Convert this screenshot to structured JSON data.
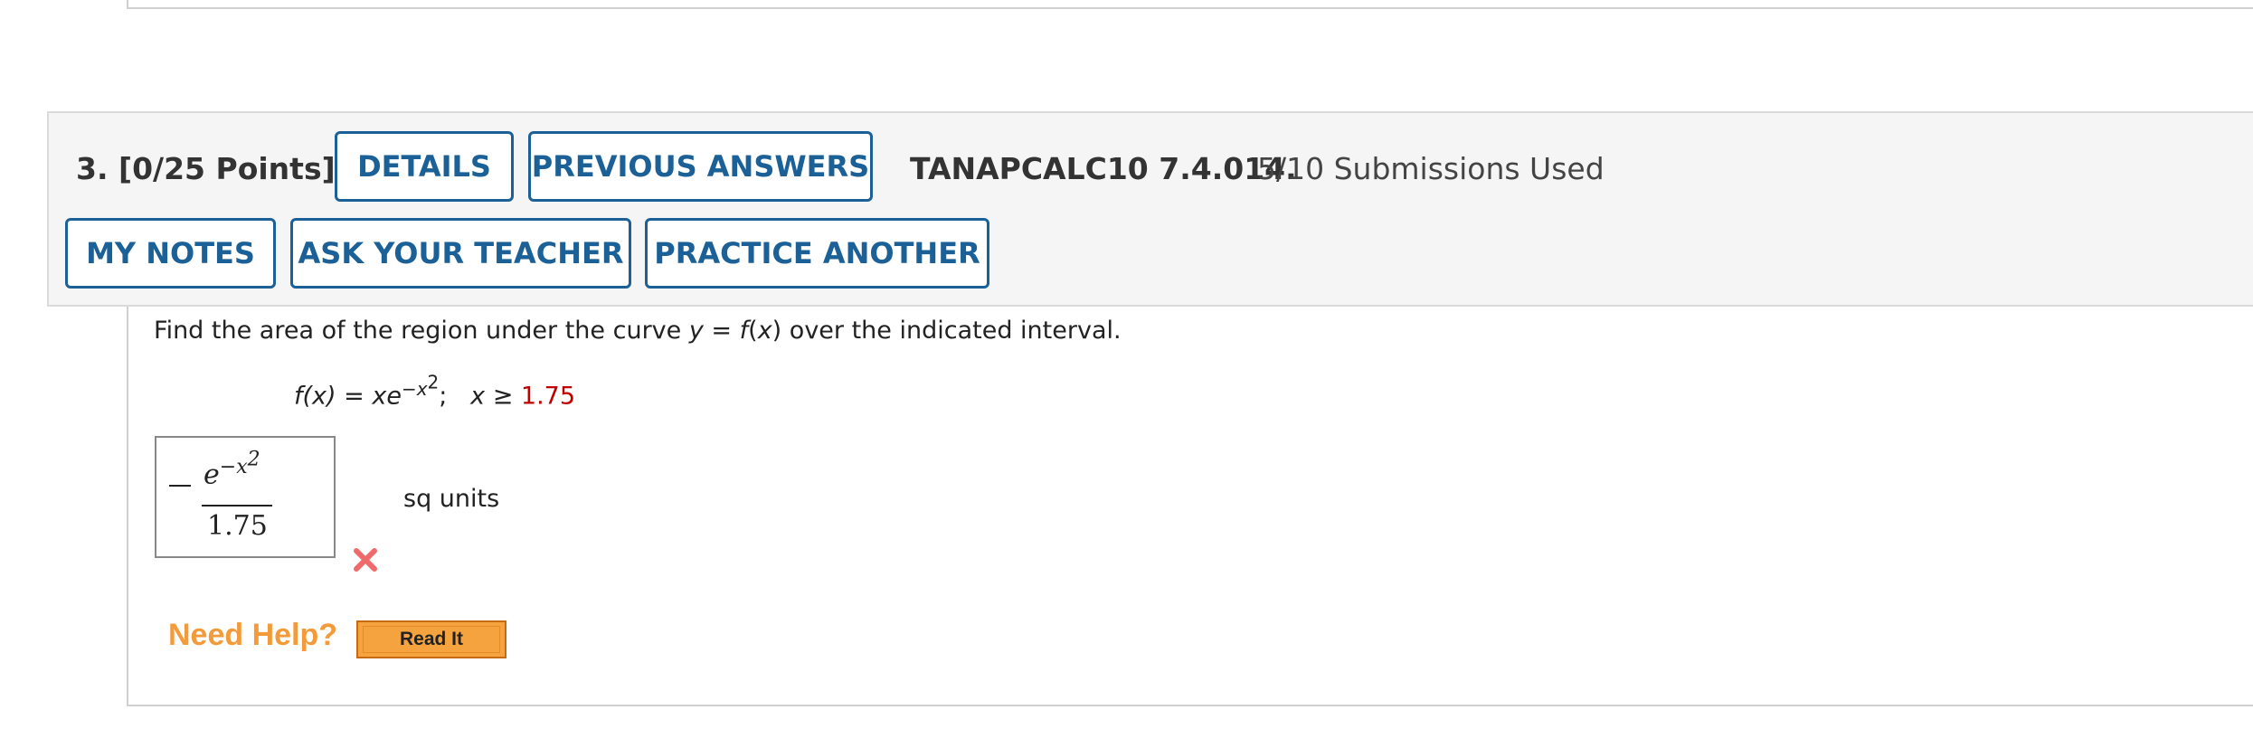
{
  "header": {
    "question_number": "3.",
    "points": "[0/25 Points]",
    "details_label": "DETAILS",
    "previous_answers_label": "PREVIOUS ANSWERS",
    "assignment_id": "TANAPCALC10 7.4.014.",
    "submissions": "5/10 Submissions Used",
    "my_notes_label": "MY NOTES",
    "ask_teacher_label": "ASK YOUR TEACHER",
    "practice_another_label": "PRACTICE ANOTHER"
  },
  "question": {
    "prefix": "Find the area of the region under the curve ",
    "y_var": "y",
    "equals": " = ",
    "fx": "f",
    "open_paren": "(",
    "x_var": "x",
    "close_paren": ")",
    "suffix": " over the indicated interval."
  },
  "function": {
    "lhs": "f(x)",
    "equals": " = ",
    "base": "xe",
    "exponent": "−x",
    "exponent_power": "2",
    "separator": ";",
    "condition_var": "x",
    "condition_op": " ≥ ",
    "condition_value": "1.75"
  },
  "answer": {
    "numerator_base": "e",
    "numerator_exp": "−x",
    "numerator_exp_power": "2",
    "denominator": "1.75",
    "units": "sq units",
    "status": "incorrect"
  },
  "help": {
    "need_help_label": "Need Help?",
    "read_it_label": "Read It"
  },
  "colors": {
    "button_blue": "#1b6096",
    "red_value": "#c00000",
    "wrong_icon": "#ef6b6b",
    "need_help_orange": "#f39b3a",
    "read_it_orange": "#f5a33e"
  }
}
